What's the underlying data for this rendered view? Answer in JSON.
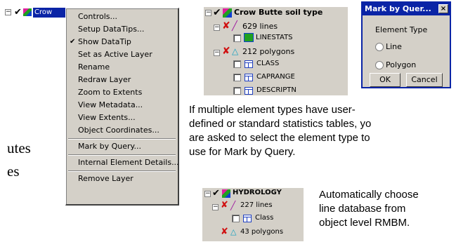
{
  "left_layer": {
    "label": "Crow"
  },
  "context_menu": {
    "items": [
      {
        "label": "Controls...",
        "checked": false
      },
      {
        "label": "Setup DataTips...",
        "checked": false
      },
      {
        "label": "Show DataTip",
        "checked": true
      },
      {
        "label": "Set as Active Layer",
        "checked": false
      },
      {
        "label": "Rename",
        "checked": false
      },
      {
        "label": "Redraw Layer",
        "checked": false
      },
      {
        "label": "Zoom to Extents",
        "checked": false
      },
      {
        "label": "View Metadata...",
        "checked": false
      },
      {
        "label": "View Extents...",
        "checked": false
      },
      {
        "label": "Object Coordinates...",
        "checked": false
      },
      {
        "label": "Mark by Query...",
        "checked": false
      },
      {
        "label": "Internal Element Details...",
        "checked": false
      },
      {
        "label": "Remove Layer",
        "checked": false
      }
    ]
  },
  "side_text": {
    "line1": "utes",
    "line2": "es"
  },
  "tree1": {
    "layer_title": "Crow Butte soil type",
    "lines_label": "629 lines",
    "lines_table": "LINESTATS",
    "polygons_label": "212 polygons",
    "poly_tables": [
      "CLASS",
      "CAPRANGE",
      "DESCRIPTN"
    ]
  },
  "dialog": {
    "title": "Mark by Quer...",
    "close_glyph": "×",
    "group_label": "Element Type",
    "options": [
      "Line",
      "Polygon"
    ],
    "ok_label": "OK",
    "cancel_label": "Cancel"
  },
  "caption1": {
    "line1": "If multiple element types have user-",
    "line2": "defined or standard statistics tables, yo",
    "line3": "are asked to select the element type to",
    "line4": "use for Mark by Query."
  },
  "tree2": {
    "layer_title": "HYDROLOGY",
    "lines_label": "227 lines",
    "lines_table": "Class",
    "polygons_label": "43 polygons"
  },
  "caption2": {
    "line1": "Automatically choose",
    "line2": "line database from",
    "line3": "object level RMBM."
  },
  "colors": {
    "selection": "#0a24a6",
    "menu_bg": "#d4d0c8",
    "dialog_border": "#0a24a6"
  }
}
